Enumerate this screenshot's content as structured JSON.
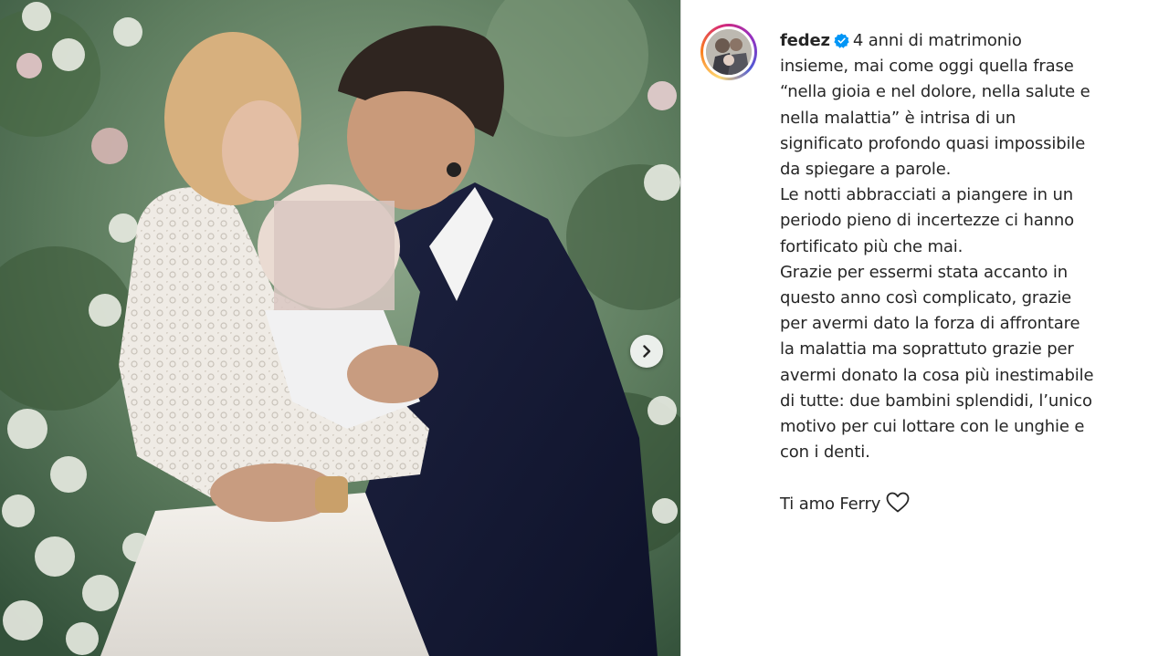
{
  "post": {
    "author": {
      "username": "fedez",
      "verified": true,
      "verified_icon": "verified-badge-icon",
      "avatar_icon": "avatar"
    },
    "media": {
      "carousel_next_icon": "chevron-right-icon"
    },
    "caption": {
      "first_line_text": "4 anni di matrimonio",
      "lines": [
        "insieme, mai come oggi quella frase",
        "“nella gioia e nel dolore, nella salute e",
        "nella malattia” è intrisa di un",
        "significato profondo quasi impossibile",
        "da spiegare a parole.",
        "Le notti abbracciati a piangere in un",
        "periodo pieno di incertezze ci hanno",
        "fortificato più che mai.",
        "Grazie per essermi stata accanto in",
        "questo anno così complicato, grazie",
        "per avermi dato la forza di affrontare",
        "la malattia ma soprattuto grazie per",
        "avermi donato la cosa più inestimabile",
        "di tutte: due bambini splendidi, l’unico",
        "motivo per cui lottare con le unghie e",
        "con i denti."
      ],
      "closing": "Ti amo Ferry",
      "closing_icon": "heart-outline-icon"
    },
    "colors": {
      "verified_blue": "#0095f6",
      "text": "#262626"
    }
  }
}
